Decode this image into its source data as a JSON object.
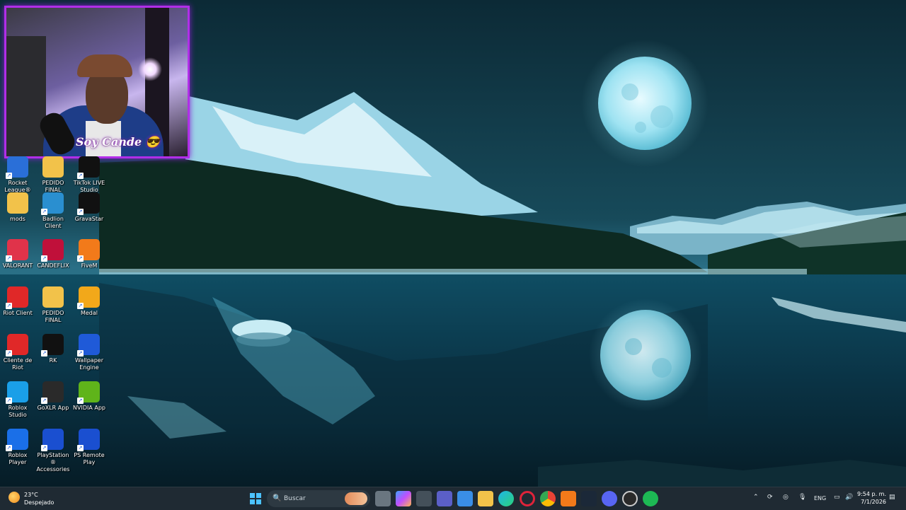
{
  "desktop_icons": [
    {
      "label": "Rocket League®",
      "icon": "rocket-league-icon",
      "color": "#2a6fd8"
    },
    {
      "label": "PEDIDO FINAL",
      "icon": "folder-icon",
      "color": "#f2c24a"
    },
    {
      "label": "TikTok LIVE Studio",
      "icon": "tiktok-live-icon",
      "color": "#111111"
    },
    {
      "label": "mods",
      "icon": "folder-icon",
      "color": "#f2c24a"
    },
    {
      "label": "Badlion Client",
      "icon": "badlion-icon",
      "color": "#2a8fd0"
    },
    {
      "label": "GravaStar",
      "icon": "gravastar-icon",
      "color": "#111111"
    },
    {
      "label": "VALORANT",
      "icon": "valorant-icon",
      "color": "#e0334a"
    },
    {
      "label": "CANDEFLIX",
      "icon": "candeflix-icon",
      "color": "#c0103a"
    },
    {
      "label": "FiveM",
      "icon": "fivem-icon",
      "color": "#f27a1a"
    },
    {
      "label": "Riot Client",
      "icon": "riot-client-icon",
      "color": "#e02828"
    },
    {
      "label": "PEDIDO FINAL",
      "icon": "folder-icon",
      "color": "#f2c24a"
    },
    {
      "label": "Medal",
      "icon": "medal-icon",
      "color": "#f2a81a"
    },
    {
      "label": "Cliente de Riot",
      "icon": "riot-client-icon",
      "color": "#e02828"
    },
    {
      "label": "RK",
      "icon": "rk-icon",
      "color": "#111111"
    },
    {
      "label": "Wallpaper Engine",
      "icon": "wallpaper-engine-icon",
      "color": "#1f5ad8"
    },
    {
      "label": "Roblox Studio",
      "icon": "roblox-studio-icon",
      "color": "#1a9fe8"
    },
    {
      "label": "GoXLR App",
      "icon": "goxlr-icon",
      "color": "#2a2a2a"
    },
    {
      "label": "NVIDIA App",
      "icon": "nvidia-icon",
      "color": "#5fb41a"
    },
    {
      "label": "Roblox Player",
      "icon": "roblox-player-icon",
      "color": "#1a6fe8"
    },
    {
      "label": "PlayStation® Accessories",
      "icon": "playstation-icon",
      "color": "#1a4fd0"
    },
    {
      "label": "PS Remote Play",
      "icon": "ps-remote-play-icon",
      "color": "#1a4fd0"
    }
  ],
  "webcam": {
    "brand_text": "Soy Cande 😎"
  },
  "taskbar": {
    "weather": {
      "temperature": "23°C",
      "condition": "Despejado"
    },
    "search_placeholder": "Buscar",
    "pinned_apps": [
      "start-icon",
      "task-view-icon",
      "copilot-icon",
      "arc-icon",
      "teams-icon",
      "store-icon",
      "file-explorer-icon",
      "edge-icon",
      "opera-gx-icon",
      "chrome-icon",
      "fivem-icon",
      "steam-icon",
      "discord-icon",
      "obs-icon",
      "spotify-icon"
    ],
    "tray": {
      "language": "ENG",
      "time": "9:54 p. m.",
      "date": "7/1/2026"
    }
  },
  "colors": {
    "webcam_border": "#b12ee8",
    "taskbar_bg": "#1f2a33"
  }
}
